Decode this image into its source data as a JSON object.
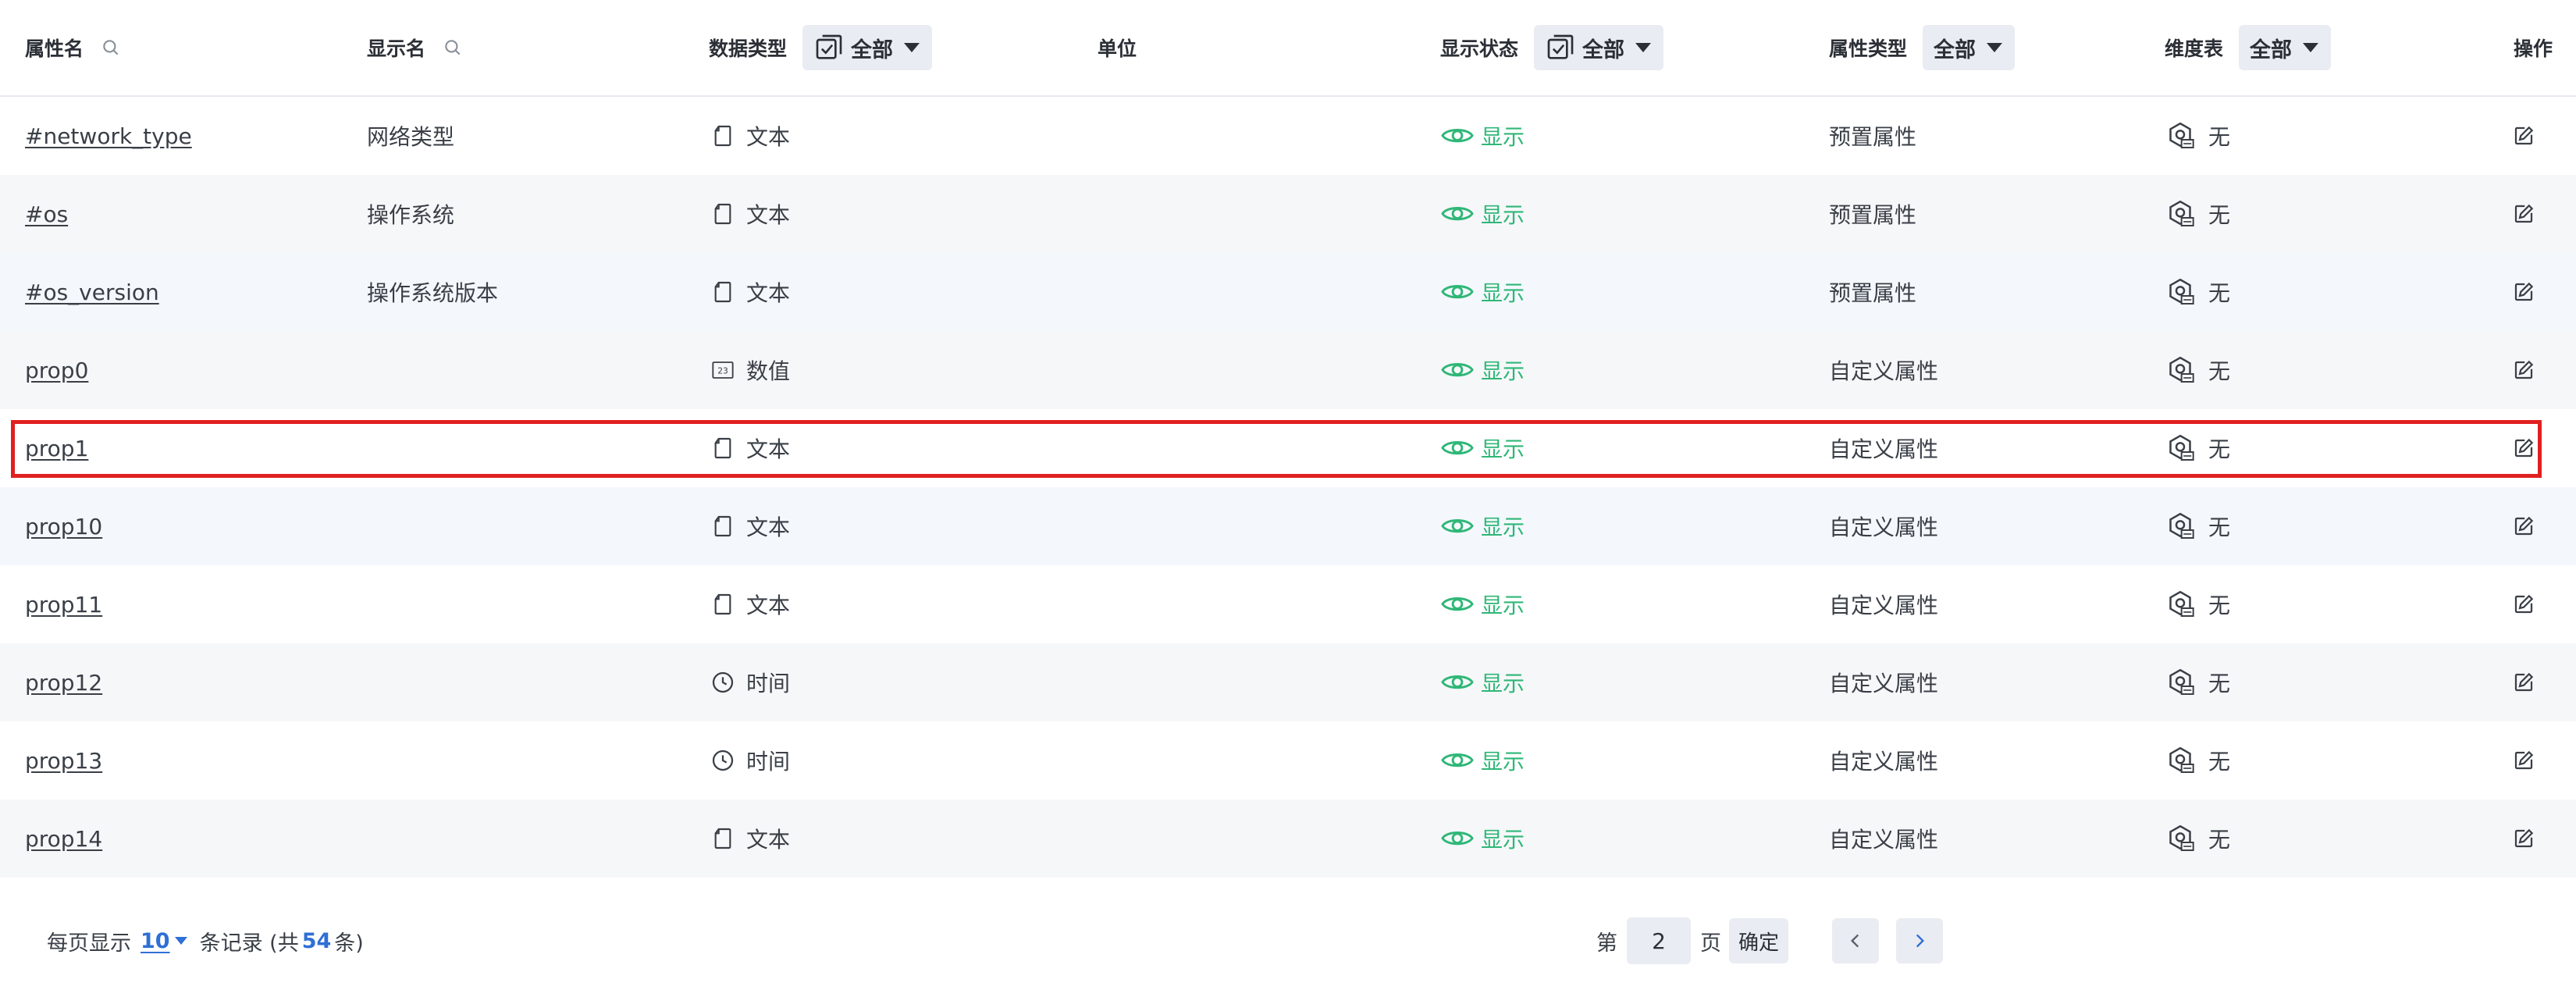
{
  "columns": {
    "name": "属性名",
    "display_name": "显示名",
    "data_type": "数据类型",
    "data_type_filter": "全部",
    "unit": "单位",
    "status": "显示状态",
    "status_filter": "全部",
    "attr_type": "属性类型",
    "attr_type_filter": "全部",
    "dim_table": "维度表",
    "dim_table_filter": "全部",
    "action": "操作"
  },
  "rows": [
    {
      "name": "#network_type",
      "display_name": "网络类型",
      "data_type": "文本",
      "type_icon": "text-doc-icon",
      "unit": "",
      "status": "显示",
      "attr_type": "预置属性",
      "dim_table": "无"
    },
    {
      "name": "#os",
      "display_name": "操作系统",
      "data_type": "文本",
      "type_icon": "text-doc-icon",
      "unit": "",
      "status": "显示",
      "attr_type": "预置属性",
      "dim_table": "无"
    },
    {
      "name": "#os_version",
      "display_name": "操作系统版本",
      "data_type": "文本",
      "type_icon": "text-doc-icon",
      "unit": "",
      "status": "显示",
      "attr_type": "预置属性",
      "dim_table": "无"
    },
    {
      "name": "prop0",
      "display_name": "",
      "data_type": "数值",
      "type_icon": "number-icon",
      "unit": "",
      "status": "显示",
      "attr_type": "自定义属性",
      "dim_table": "无"
    },
    {
      "name": "prop1",
      "display_name": "",
      "data_type": "文本",
      "type_icon": "text-doc-icon",
      "unit": "",
      "status": "显示",
      "attr_type": "自定义属性",
      "dim_table": "无"
    },
    {
      "name": "prop10",
      "display_name": "",
      "data_type": "文本",
      "type_icon": "text-doc-icon",
      "unit": "",
      "status": "显示",
      "attr_type": "自定义属性",
      "dim_table": "无"
    },
    {
      "name": "prop11",
      "display_name": "",
      "data_type": "文本",
      "type_icon": "text-doc-icon",
      "unit": "",
      "status": "显示",
      "attr_type": "自定义属性",
      "dim_table": "无"
    },
    {
      "name": "prop12",
      "display_name": "",
      "data_type": "时间",
      "type_icon": "clock-icon",
      "unit": "",
      "status": "显示",
      "attr_type": "自定义属性",
      "dim_table": "无"
    },
    {
      "name": "prop13",
      "display_name": "",
      "data_type": "时间",
      "type_icon": "clock-icon",
      "unit": "",
      "status": "显示",
      "attr_type": "自定义属性",
      "dim_table": "无"
    },
    {
      "name": "prop14",
      "display_name": "",
      "data_type": "文本",
      "type_icon": "text-doc-icon",
      "unit": "",
      "status": "显示",
      "attr_type": "自定义属性",
      "dim_table": "无"
    }
  ],
  "footer": {
    "per_page_prefix": "每页显示",
    "page_size": "10",
    "per_page_suffix": "条记录 (共",
    "total": "54",
    "total_suffix": "条)",
    "page_prefix": "第",
    "current_page": "2",
    "page_suffix": "页",
    "confirm": "确定"
  },
  "colors": {
    "status_green": "#2fb777",
    "link_blue": "#2f6fd6",
    "highlight_red": "#e02020",
    "header_border": "#e6e9ef",
    "pill_bg": "#e9ecf2"
  }
}
